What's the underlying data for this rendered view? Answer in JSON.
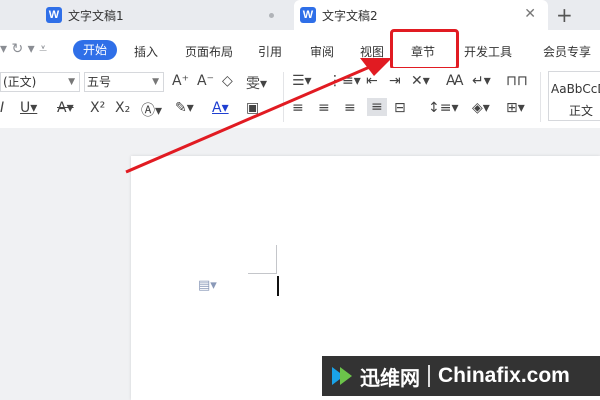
{
  "tabs": [
    {
      "label": "文字文稿1"
    },
    {
      "label": "文字文稿2"
    }
  ],
  "doc_icon_letter": "W",
  "new_tab_symbol": "+",
  "close_symbol": "✕",
  "ribbon": {
    "active": "开始",
    "items": [
      "插入",
      "页面布局",
      "引用",
      "审阅",
      "视图",
      "章节",
      "开发工具",
      "会员专享"
    ]
  },
  "toolbar": {
    "font_name": "(正文)",
    "font_size": "五号",
    "style_preview": "AaBbCcD",
    "style_name": "正文"
  },
  "watermark": {
    "cn": "迅维网",
    "en": "Chinafix.com"
  },
  "colors": {
    "accent": "#2f6fe8",
    "highlight": "#e11b22"
  }
}
